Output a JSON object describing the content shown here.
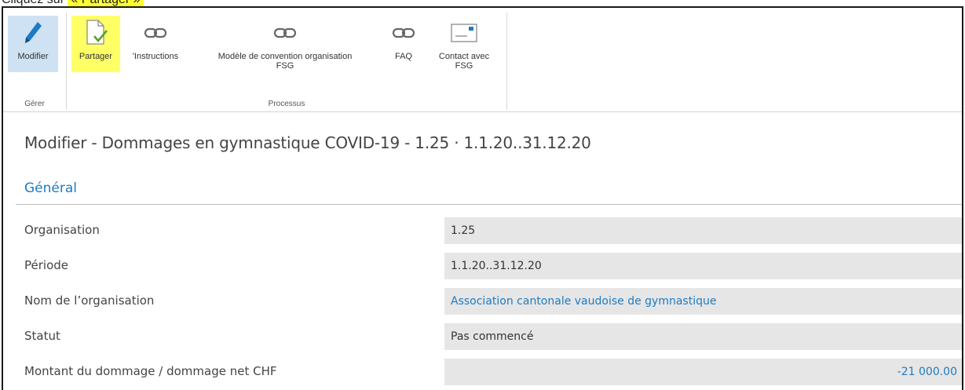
{
  "caption": {
    "prefix": "Cliquez sur ",
    "highlight": "« Partager »"
  },
  "ribbon": {
    "groups": [
      {
        "label": "Gérer"
      },
      {
        "label": "Processus"
      }
    ],
    "buttons": [
      {
        "label": "Modifier",
        "icon": "pencil-icon"
      },
      {
        "label": "Partager",
        "icon": "share-document-icon"
      },
      {
        "label": "'Instructions",
        "icon": "link-icon"
      },
      {
        "label_line1": "Modèle de convention organisation",
        "label_line2": "FSG",
        "icon": "link-icon"
      },
      {
        "label": "FAQ",
        "icon": "link-icon"
      },
      {
        "label_line1": "Contact avec",
        "label_line2": "FSG",
        "icon": "contact-card-icon"
      }
    ]
  },
  "page": {
    "title": "Modifier - Dommages en gymnastique COVID-19 - 1.25 · 1.1.20..31.12.20"
  },
  "section": {
    "title": "Général"
  },
  "fields": [
    {
      "label": "Organisation",
      "value": "1.25"
    },
    {
      "label": "Période",
      "value": "1.1.20..31.12.20"
    },
    {
      "label": "Nom de l’organisation",
      "value": "Association cantonale vaudoise de gymnastique"
    },
    {
      "label": "Statut",
      "value": "Pas commencé"
    },
    {
      "label": "Montant du dommage / dommage net CHF",
      "value": "-21 000.00"
    }
  ],
  "colors": {
    "accent": "#1f7bc1",
    "highlight": "#ffff66",
    "active": "#cfe2f3",
    "field_bg": "#e6e6e6"
  }
}
